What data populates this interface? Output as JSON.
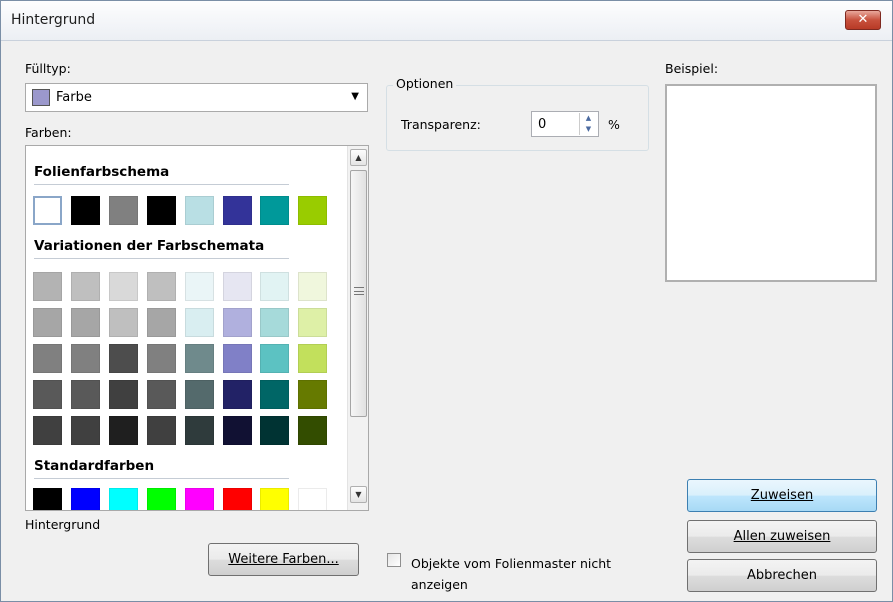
{
  "window": {
    "title": "Hintergrund",
    "close_symbol": "✕"
  },
  "fill_type": {
    "label": "Fülltyp:",
    "value": "Farbe",
    "swatch_color": "#9b98cc"
  },
  "colors": {
    "label": "Farben:",
    "sections": {
      "scheme": {
        "title": "Folienfarbschema",
        "swatches": [
          "#ffffff",
          "#000000",
          "#808080",
          "#000000",
          "#b9dfe4",
          "#333399",
          "#00999a",
          "#99cc00"
        ]
      },
      "variations": {
        "title": "Variationen der Farbschemata",
        "rows": [
          [
            "#b3b3b3",
            "#bfbfbf",
            "#d9d9d9",
            "#bfbfbf",
            "#eaf5f7",
            "#e6e6f2",
            "#e1f3f3",
            "#f0f7dd"
          ],
          [
            "#a6a6a6",
            "#a6a6a6",
            "#bfbfbf",
            "#a6a6a6",
            "#d9eef1",
            "#b0b0de",
            "#a6dada",
            "#def0a7"
          ],
          [
            "#808080",
            "#808080",
            "#4d4d4d",
            "#808080",
            "#6f8a8c",
            "#8080c7",
            "#5cc2c2",
            "#c2e05c"
          ],
          [
            "#595959",
            "#595959",
            "#404040",
            "#595959",
            "#546a6c",
            "#222266",
            "#006666",
            "#667a00"
          ],
          [
            "#404040",
            "#404040",
            "#1f1f1f",
            "#404040",
            "#2f3b3c",
            "#111133",
            "#003333",
            "#334d00"
          ]
        ]
      },
      "standard": {
        "title": "Standardfarben",
        "swatches": [
          "#000000",
          "#0000ff",
          "#00ffff",
          "#00ff00",
          "#ff00ff",
          "#ff0000",
          "#ffff00",
          "#ffffff"
        ]
      }
    }
  },
  "preview_text": "Hintergrund",
  "more_colors_button": "Weitere Farben...",
  "options": {
    "label": "Optionen",
    "transparency_label": "Transparenz:",
    "transparency_value": "0",
    "unit": "%"
  },
  "example": {
    "label": "Beispiel:"
  },
  "buttons": {
    "apply": "Zuweisen",
    "apply_all": "Allen zuweisen",
    "cancel": "Abbrechen"
  },
  "hide_master_objects": {
    "label": "Objekte vom Folienmaster nicht anzeigen",
    "checked": false
  }
}
